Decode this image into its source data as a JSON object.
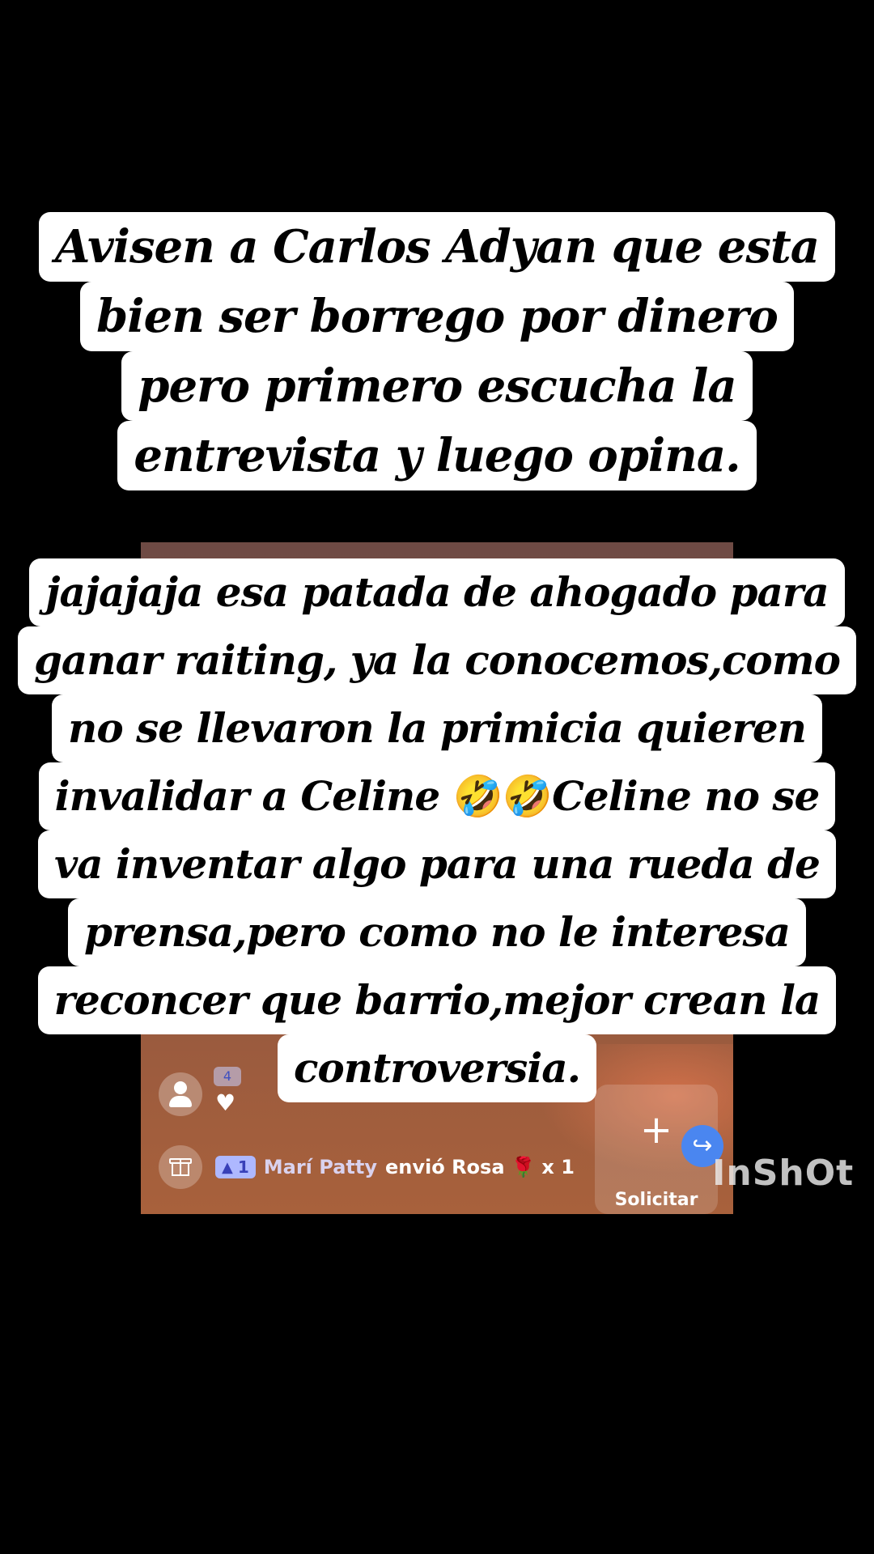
{
  "caption_top": {
    "lines": [
      "Avisen a Carlos Adyan que esta",
      "bien ser borrego por dinero",
      "pero primero escucha la",
      "entrevista y luego opina."
    ]
  },
  "caption_bottom": {
    "lines": [
      "jajajaja esa patada de ahogado para",
      "ganar raiting, ya la conocemos,como",
      "no se llevaron la primicia quieren",
      "invalidar a Celine ",
      "va inventar algo para una rueda de",
      "prensa,pero como no le interesa",
      "reconcer que barrio,mejor crean la",
      "controversia."
    ],
    "line4_emoji": "🤣🤣",
    "line4_tail": "Celine no se"
  },
  "live_overlay": {
    "mini_badge": "4",
    "mini_heart": "♥",
    "gift_row": {
      "level": "1",
      "level_icon": "▲",
      "user": "Marí Patty",
      "action": "envió Rosa",
      "rose": "🌹",
      "count": "x 1"
    },
    "request_label": "Solicitar",
    "request_plus": "+",
    "share_icon": "↪"
  },
  "watermark": "InShOt",
  "colors": {
    "background": "#000000",
    "caption_bg": "#ffffff",
    "caption_text": "#000000",
    "level_badge": "#aeb8ff",
    "share_button": "#4a86f0"
  }
}
